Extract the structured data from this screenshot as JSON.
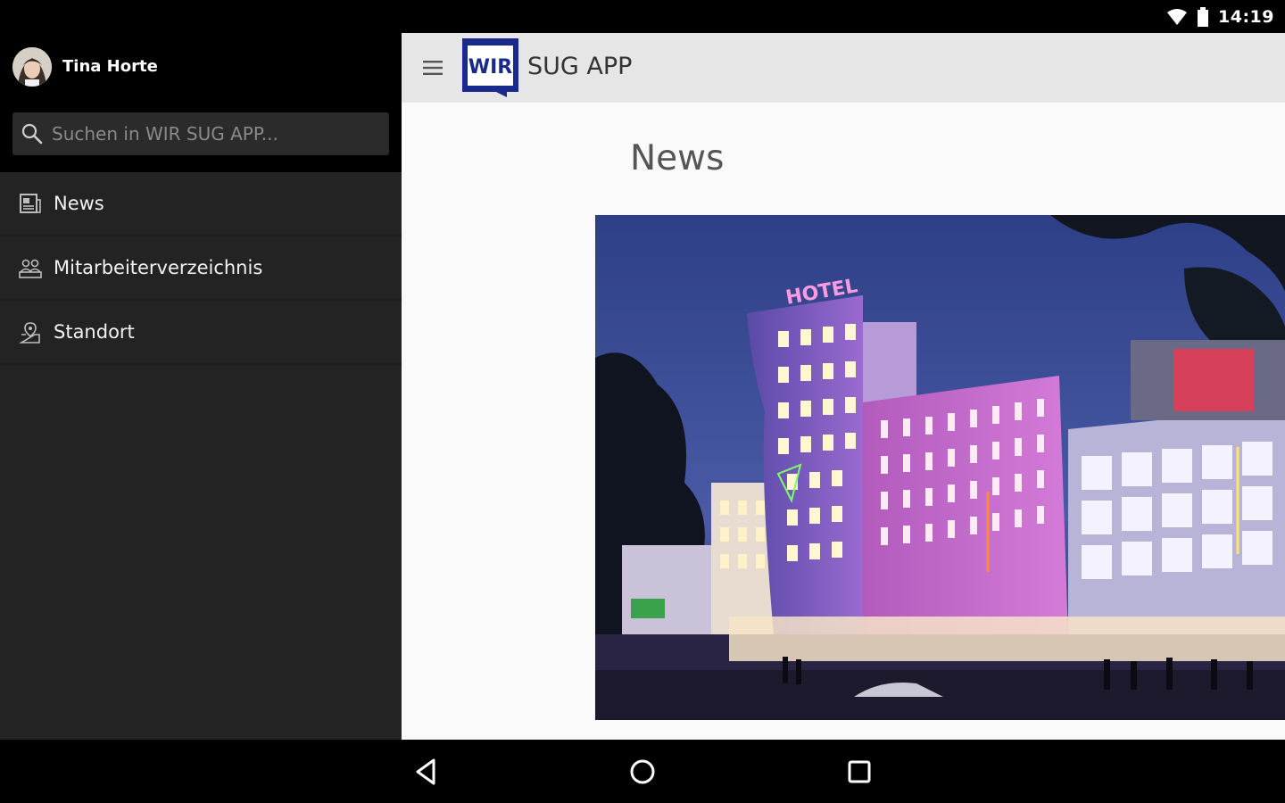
{
  "status_bar": {
    "time": "14:19",
    "icons": [
      "wifi-icon",
      "battery-icon"
    ]
  },
  "drawer": {
    "user_name": "Tina Horte",
    "search": {
      "placeholder": "Suchen in WIR SUG APP...",
      "value": ""
    },
    "items": [
      {
        "label": "News",
        "icon": "newspaper-icon",
        "active": true
      },
      {
        "label": "Mitarbeiterverzeichnis",
        "icon": "people-icon",
        "active": false
      },
      {
        "label": "Standort",
        "icon": "location-icon",
        "active": false
      }
    ],
    "colors": {
      "background": "#232323",
      "header": "#000000"
    }
  },
  "toolbar": {
    "logo_text": "WIR",
    "app_title": "SUG APP",
    "colors": {
      "logo": "#1a2a8c",
      "background": "#e6e6e6"
    }
  },
  "main": {
    "page_title": "News",
    "image_subject": "hotel-building-rendering",
    "image_words": {
      "hotel_sign": "HOTEL"
    }
  },
  "system_nav": {
    "buttons": [
      "back-icon",
      "home-icon",
      "recents-icon"
    ]
  }
}
